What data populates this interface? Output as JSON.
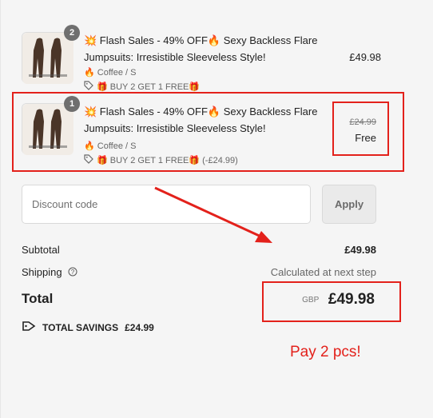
{
  "items": [
    {
      "quantity": "2",
      "title": "💥 Flash Sales - 49% OFF🔥 Sexy Backless Flare Jumpsuits: Irresistible Sleeveless Style!",
      "variant": "🔥 Coffee / S",
      "promo": "🎁 BUY 2 GET 1 FREE🎁",
      "price": "£49.98"
    },
    {
      "quantity": "1",
      "title": "💥 Flash Sales - 49% OFF🔥 Sexy Backless Flare Jumpsuits: Irresistible Sleeveless Style!",
      "variant": "🔥 Coffee / S",
      "promo": "🎁 BUY 2 GET 1 FREE🎁  (-£24.99)",
      "original_price": "£24.99",
      "price": "Free"
    }
  ],
  "discount": {
    "placeholder": "Discount code",
    "apply_label": "Apply"
  },
  "summary": {
    "subtotal_label": "Subtotal",
    "subtotal_value": "£49.98",
    "shipping_label": "Shipping",
    "shipping_value": "Calculated at next step",
    "total_label": "Total",
    "currency": "GBP",
    "total_value": "£49.98",
    "savings_label": "TOTAL SAVINGS",
    "savings_value": "£24.99"
  },
  "annotation": {
    "text": "Pay 2 pcs!",
    "color": "#e3211b"
  },
  "icons": [
    "tag-icon",
    "help-circle-icon",
    "savings-tag-icon"
  ]
}
